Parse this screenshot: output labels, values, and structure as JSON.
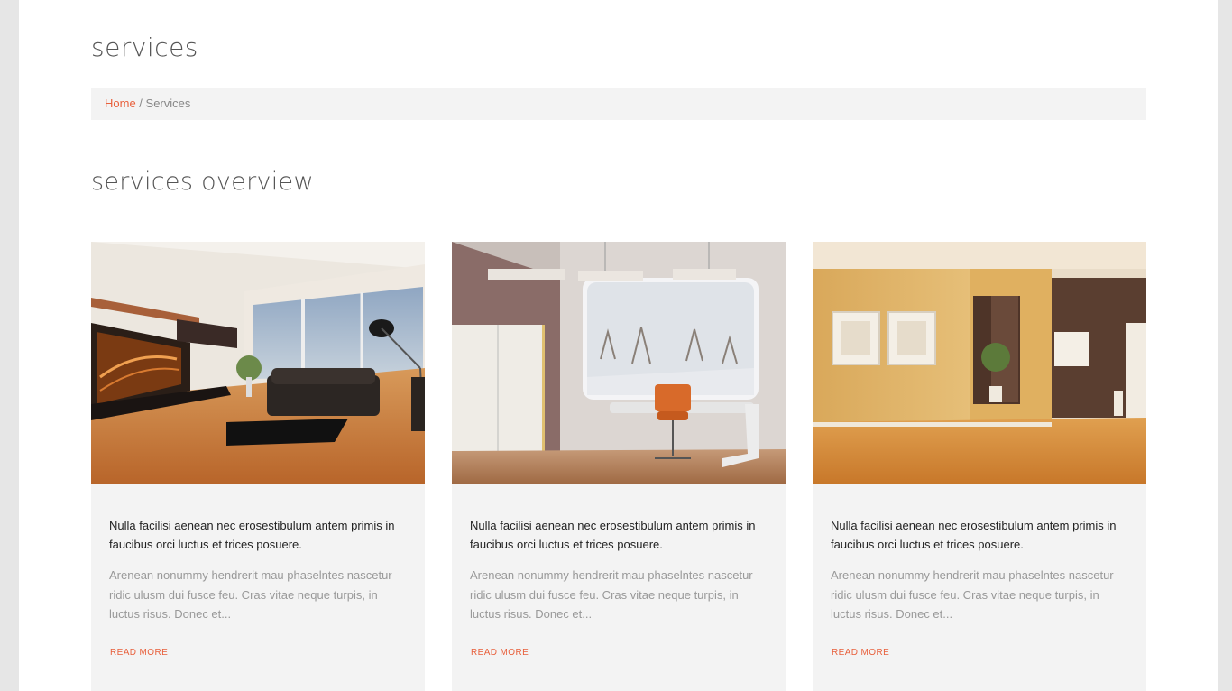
{
  "header": {
    "title": "services"
  },
  "breadcrumb": {
    "home": "Home",
    "separator": " / ",
    "current": "Services"
  },
  "overview": {
    "title": "services overview"
  },
  "cards": [
    {
      "image": "living-room-photo",
      "lead": "Nulla facilisi aenean nec erosestibulum antem primis in faucibus orci luctus et trices posuere.",
      "text": "Arenean nonummy hendrerit mau phaselntes nascetur ridic ulusm dui fusce feu. Cras vitae neque turpis, in luctus risus. Donec et...",
      "more": "READ MORE"
    },
    {
      "image": "office-room-photo",
      "lead": "Nulla facilisi aenean nec erosestibulum antem primis in faucibus orci luctus et trices posuere.",
      "text": "Arenean nonummy hendrerit mau phaselntes nascetur ridic ulusm dui fusce feu. Cras vitae neque turpis, in luctus risus. Donec et...",
      "more": "READ MORE"
    },
    {
      "image": "empty-hall-photo",
      "lead": "Nulla facilisi aenean nec erosestibulum antem primis in faucibus orci luctus et trices posuere.",
      "text": "Arenean nonummy hendrerit mau phaselntes nascetur ridic ulusm dui fusce feu. Cras vitae neque turpis, in luctus risus. Donec et...",
      "more": "READ MORE"
    }
  ],
  "colors": {
    "accent": "#e8603c",
    "panel": "#f3f3f3",
    "muted_text": "#999999"
  }
}
